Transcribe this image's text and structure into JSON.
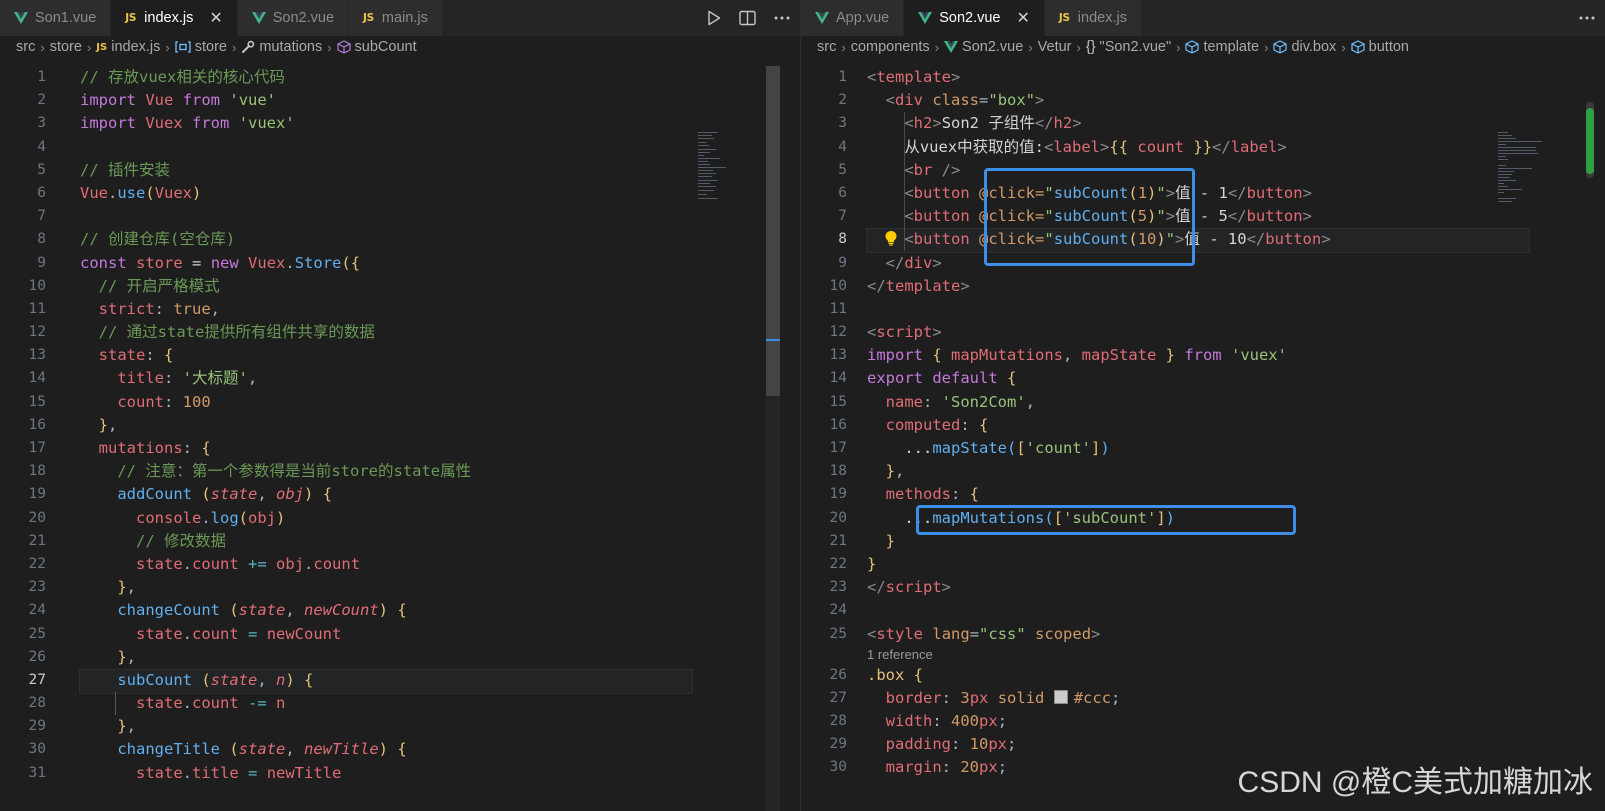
{
  "left": {
    "tabs": [
      {
        "icon": "vue",
        "label": "Son1.vue"
      },
      {
        "icon": "js",
        "label": "index.js",
        "close": "✕"
      },
      {
        "icon": "vue",
        "label": "Son2.vue"
      },
      {
        "icon": "js",
        "label": "main.js"
      }
    ],
    "breadcrumb": [
      "src",
      "store",
      "index.js",
      "store",
      "mutations",
      "subCount"
    ],
    "js_badge": "JS",
    "line_numbers": [
      "1",
      "2",
      "3",
      "4",
      "5",
      "6",
      "7",
      "8",
      "9",
      "10",
      "11",
      "12",
      "13",
      "14",
      "15",
      "16",
      "17",
      "18",
      "19",
      "20",
      "21",
      "22",
      "23",
      "24",
      "25",
      "26",
      "27",
      "28",
      "29",
      "30",
      "31"
    ],
    "code": [
      [
        "// 存放vuex相关的核心代码"
      ],
      [
        "import",
        " ",
        "Vue",
        " ",
        "from",
        " ",
        "'vue'"
      ],
      [
        "import",
        " ",
        "Vuex",
        " ",
        "from",
        " ",
        "'vuex'"
      ],
      [
        ""
      ],
      [
        "// 插件安装"
      ],
      [
        "Vue",
        ".",
        "use",
        "(",
        "Vuex",
        ")"
      ],
      [
        ""
      ],
      [
        "// 创建仓库(空仓库)"
      ],
      [
        "const",
        " ",
        "store",
        " = ",
        "new",
        " ",
        "Vuex",
        ".",
        "Store",
        "({"
      ],
      [
        "  // 开启严格模式"
      ],
      [
        "  ",
        "strict",
        ": ",
        "true",
        ","
      ],
      [
        "  // 通过state提供所有组件共享的数据"
      ],
      [
        "  ",
        "state",
        ": ",
        "{"
      ],
      [
        "    ",
        "title",
        ": ",
        "'大标题'",
        ","
      ],
      [
        "    ",
        "count",
        ": ",
        "100"
      ],
      [
        "  ",
        "}",
        ","
      ],
      [
        "  ",
        "mutations",
        ": ",
        "{"
      ],
      [
        "    // 注意：第一个参数得是当前store的state属性"
      ],
      [
        "    ",
        "addCount",
        " ",
        "(",
        "state",
        ", ",
        "obj",
        ")",
        " ",
        "{"
      ],
      [
        "      ",
        "console",
        ".",
        "log",
        "(",
        "obj",
        ")"
      ],
      [
        "      // 修改数据"
      ],
      [
        "      ",
        "state",
        ".",
        "count",
        " ",
        "+=",
        " ",
        "obj",
        ".",
        "count"
      ],
      [
        "    ",
        "}",
        ","
      ],
      [
        "    ",
        "changeCount",
        " ",
        "(",
        "state",
        ", ",
        "newCount",
        ")",
        " ",
        "{"
      ],
      [
        "      ",
        "state",
        ".",
        "count",
        " = ",
        "newCount"
      ],
      [
        "    ",
        "}",
        ","
      ],
      [
        "    ",
        "subCount",
        " ",
        "(",
        "state",
        ", ",
        "n",
        ")",
        " ",
        "{"
      ],
      [
        "      ",
        "state",
        ".",
        "count",
        " ",
        "-=",
        " ",
        "n"
      ],
      [
        "    ",
        "}",
        ","
      ],
      [
        "    ",
        "changeTitle",
        " ",
        "(",
        "state",
        ", ",
        "newTitle",
        ")",
        " ",
        "{"
      ],
      [
        "      ",
        "state",
        ".",
        "title",
        " = ",
        "newTitle"
      ]
    ]
  },
  "right": {
    "tabs": [
      {
        "icon": "vue",
        "label": "App.vue"
      },
      {
        "icon": "vue",
        "label": "Son2.vue",
        "close": "✕"
      },
      {
        "icon": "js",
        "label": "index.js"
      }
    ],
    "breadcrumb": [
      "src",
      "components",
      "Son2.vue",
      "Vetur",
      "\"Son2.vue\"",
      "template",
      "div.box",
      "button"
    ],
    "line_numbers": [
      "1",
      "2",
      "3",
      "4",
      "5",
      "6",
      "7",
      "8",
      "9",
      "10",
      "11",
      "12",
      "13",
      "14",
      "15",
      "16",
      "17",
      "18",
      "19",
      "20",
      "21",
      "22",
      "23",
      "24",
      "25",
      "26",
      "27",
      "28",
      "29",
      "30"
    ],
    "reference_text": "1 reference",
    "code": [
      [
        "<",
        "template",
        ">"
      ],
      [
        "  <",
        "div",
        " ",
        "class",
        "=",
        "\"box\"",
        ">"
      ],
      [
        "    <",
        "h2",
        ">",
        "Son2 子组件",
        "</",
        "h2",
        ">"
      ],
      [
        "    ",
        "从vuex中获取的值:",
        "<",
        "label",
        ">",
        "{{ ",
        "count",
        " }}",
        "</",
        "label",
        ">"
      ],
      [
        "    <",
        "br",
        " />"
      ],
      [
        "    <",
        "button",
        " ",
        "@click=",
        "\"",
        "subCount",
        "(",
        "1",
        ")",
        "\"",
        ">",
        "值 - 1",
        "</",
        "button",
        ">"
      ],
      [
        "    <",
        "button",
        " ",
        "@click=",
        "\"",
        "subCount",
        "(",
        "5",
        ")",
        "\"",
        ">",
        "值 - 5",
        "</",
        "button",
        ">"
      ],
      [
        "    <",
        "button",
        " ",
        "@click=",
        "\"",
        "subCount",
        "(",
        "10",
        ")",
        "\"",
        ">",
        "值 - 10",
        "</",
        "button",
        ">"
      ],
      [
        "  </",
        "div",
        ">"
      ],
      [
        "</",
        "template",
        ">"
      ],
      [
        ""
      ],
      [
        "<",
        "script",
        ">"
      ],
      [
        "import",
        " { ",
        "mapMutations",
        ", ",
        "mapState",
        " } ",
        "from",
        " ",
        "'vuex'"
      ],
      [
        "export",
        " ",
        "default",
        " {"
      ],
      [
        "  ",
        "name",
        ": ",
        "'Son2Com'",
        ","
      ],
      [
        "  ",
        "computed",
        ": ",
        "{"
      ],
      [
        "    ...",
        "mapState",
        "(",
        "[",
        "'count'",
        "]",
        ")"
      ],
      [
        "  ",
        "}",
        ","
      ],
      [
        "  ",
        "methods",
        ": ",
        "{"
      ],
      [
        "    ...",
        "mapMutations",
        "(",
        "[",
        "'subCount'",
        "]",
        ")"
      ],
      [
        "  ",
        "}"
      ],
      [
        "}"
      ],
      [
        "</",
        "script",
        ">"
      ],
      [
        ""
      ],
      [
        "<",
        "style",
        " ",
        "lang",
        "=",
        "\"css\"",
        " ",
        "scoped",
        ">"
      ],
      [
        ".box",
        " {"
      ],
      [
        "  ",
        "border",
        ": ",
        "3",
        "px",
        " ",
        "solid",
        " ",
        "#ccc",
        ";"
      ],
      [
        "  ",
        "width",
        ": ",
        "400",
        "px",
        ";"
      ],
      [
        "  ",
        "padding",
        ": ",
        "10",
        "px",
        ";"
      ],
      [
        "  ",
        "margin",
        ": ",
        "20",
        "px",
        ";"
      ]
    ]
  },
  "watermark": "CSDN @橙C美式加糖加冰",
  "colors": {
    "background": "#1e1e1e",
    "highlight_box": "#3d8ee6",
    "vue_green": "#41b883",
    "js_yellow": "#e8c34a"
  }
}
